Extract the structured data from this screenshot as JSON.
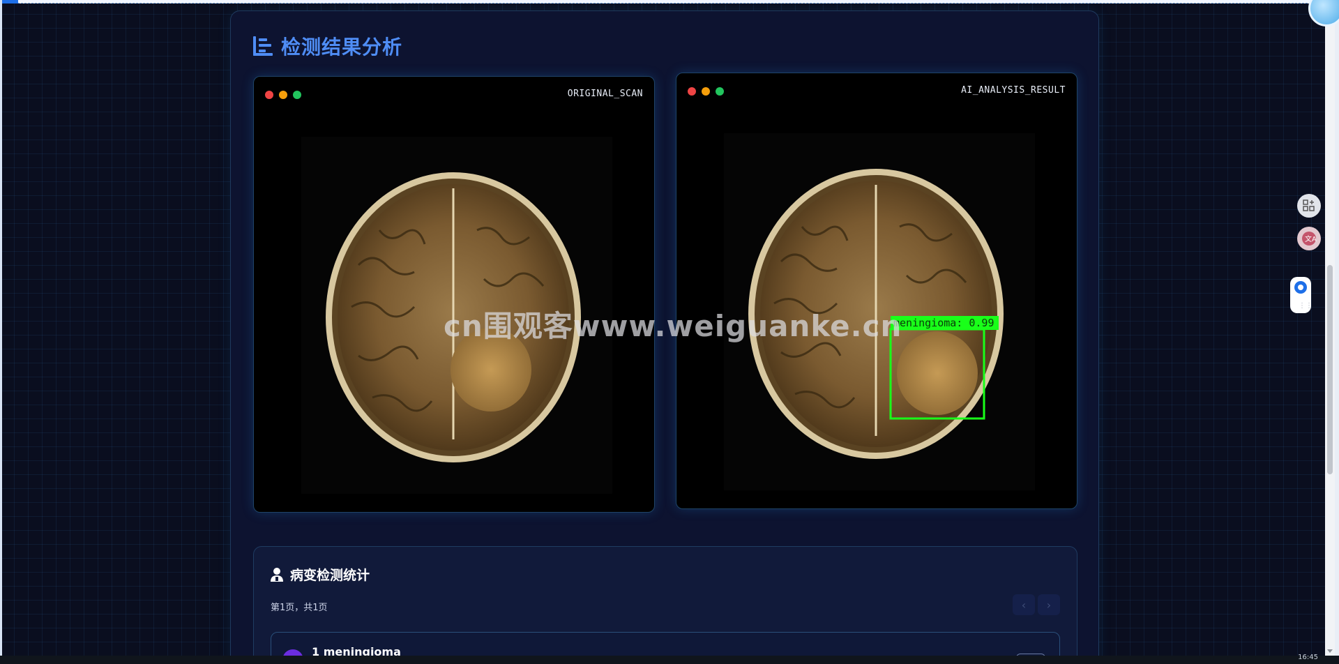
{
  "section": {
    "title": "检测结果分析"
  },
  "original_viewer": {
    "label": "ORIGINAL_SCAN"
  },
  "analysis_viewer": {
    "label": "AI_ANALYSIS_RESULT",
    "detection_label": "meningioma: 0.99",
    "box_color": "#19ff19"
  },
  "window_dots": [
    "#ef4444",
    "#f59e0b",
    "#22c55e"
  ],
  "stats": {
    "title": "病变检测统计",
    "page_info": "第1页，共1页",
    "prev_label": "‹",
    "next_label": "›",
    "items": [
      {
        "name": "1 meningioma"
      }
    ]
  },
  "watermark": "cn围观客www.weiguanke.cn",
  "taskbar": {
    "time": "16:45"
  },
  "colors": {
    "accent": "#4f8df5",
    "panel_bg": "#0d1330"
  }
}
